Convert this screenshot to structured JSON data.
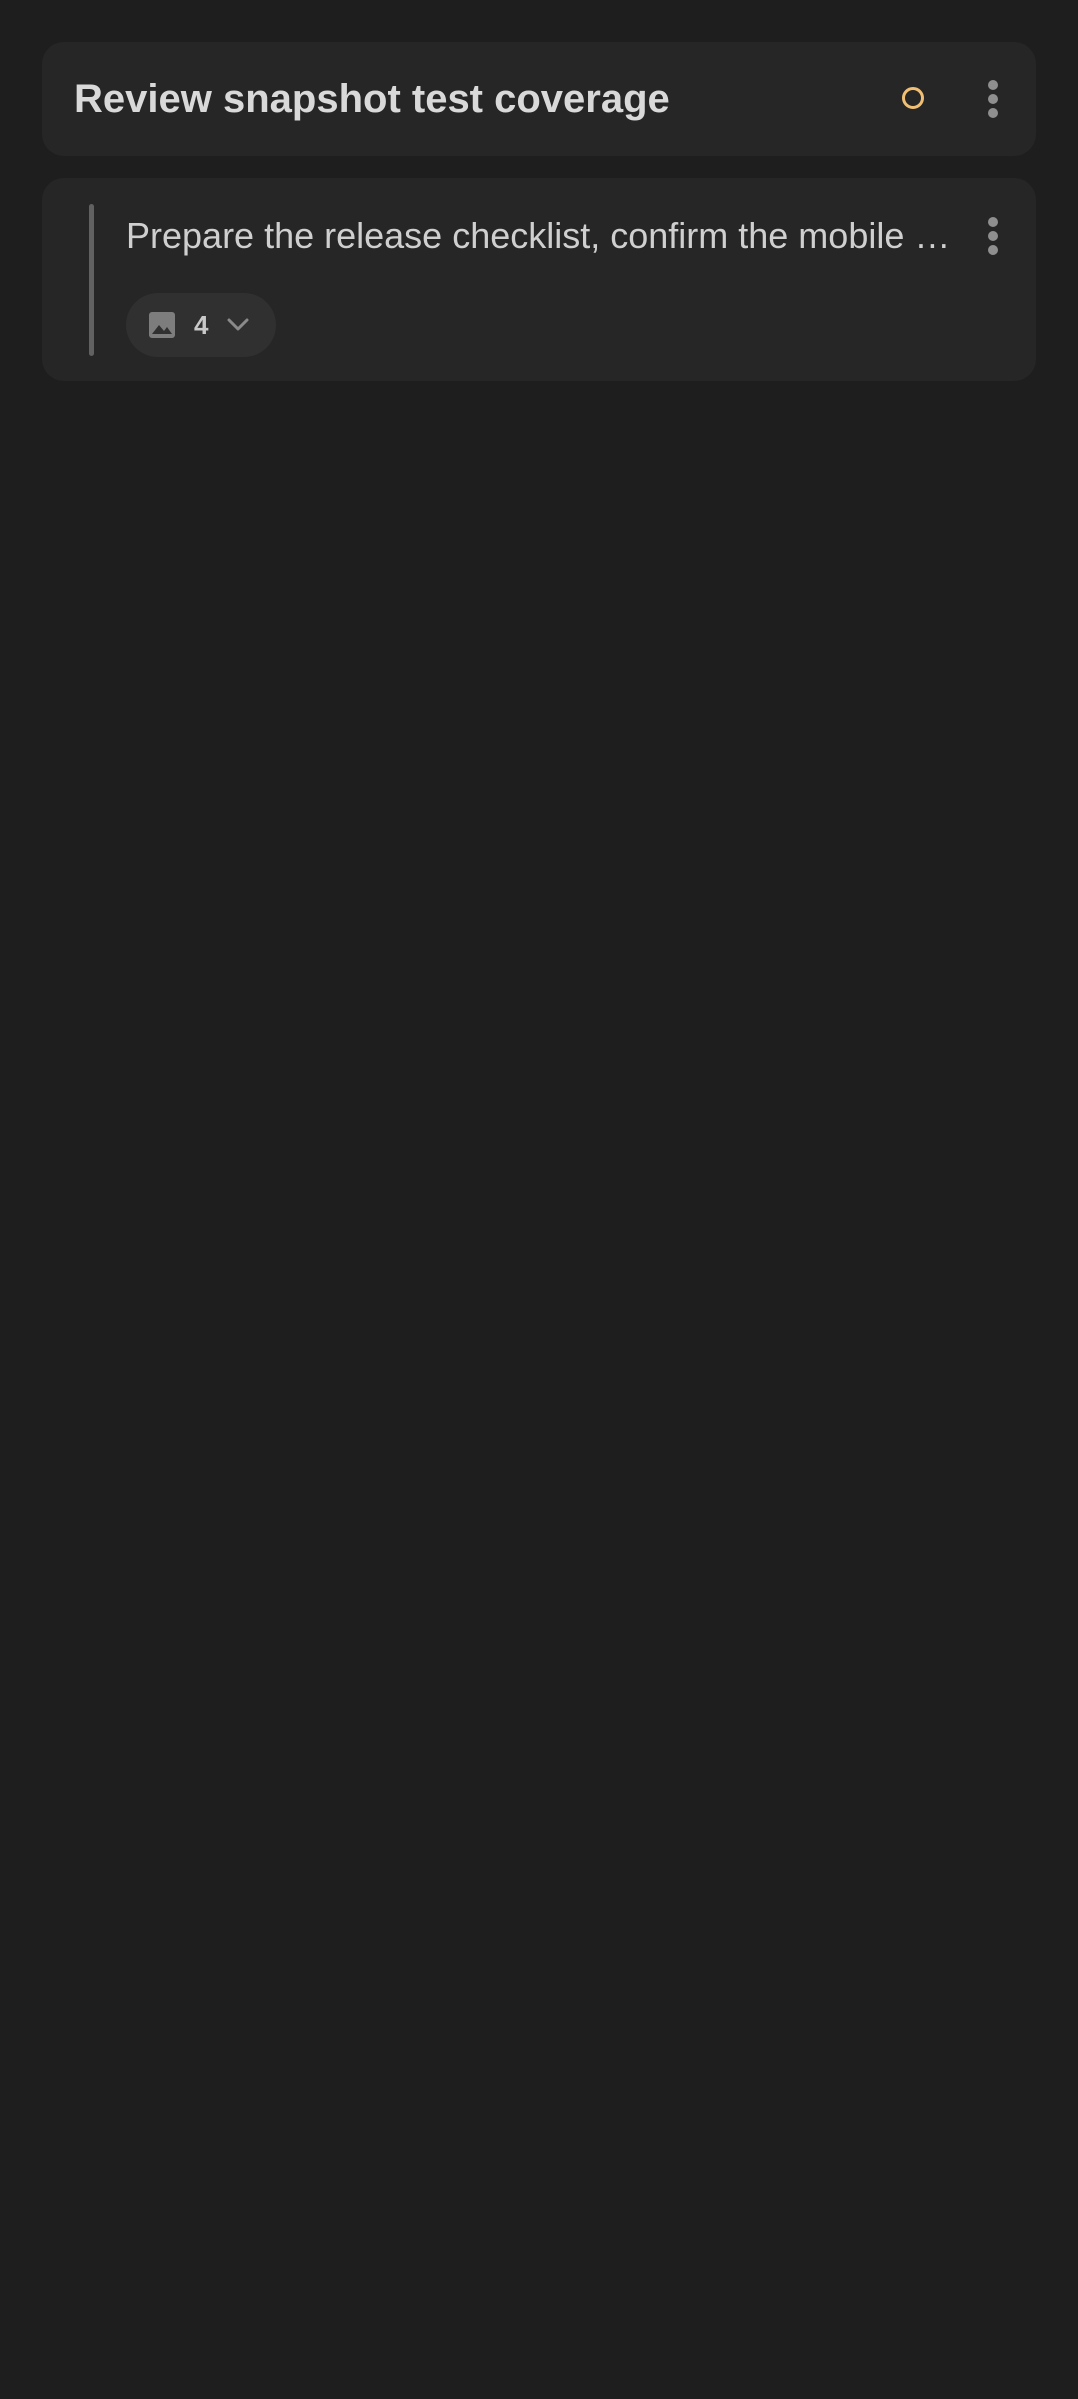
{
  "header": {
    "title": "Review snapshot test coverage",
    "status_ring_color": "#f1bf74",
    "status_icon": "status-ring-icon",
    "menu_icon": "more-vert-icon"
  },
  "item": {
    "text": "Prepare the release checklist, confirm the mobile build, and attach the latest screenshots",
    "attachment_count": "4",
    "attachment_icon": "image-icon",
    "expand_icon": "chevron-down-icon",
    "menu_icon": "more-vert-icon"
  },
  "colors": {
    "background": "#1e1e1e",
    "card": "#262626",
    "accent": "#f1bf74"
  }
}
